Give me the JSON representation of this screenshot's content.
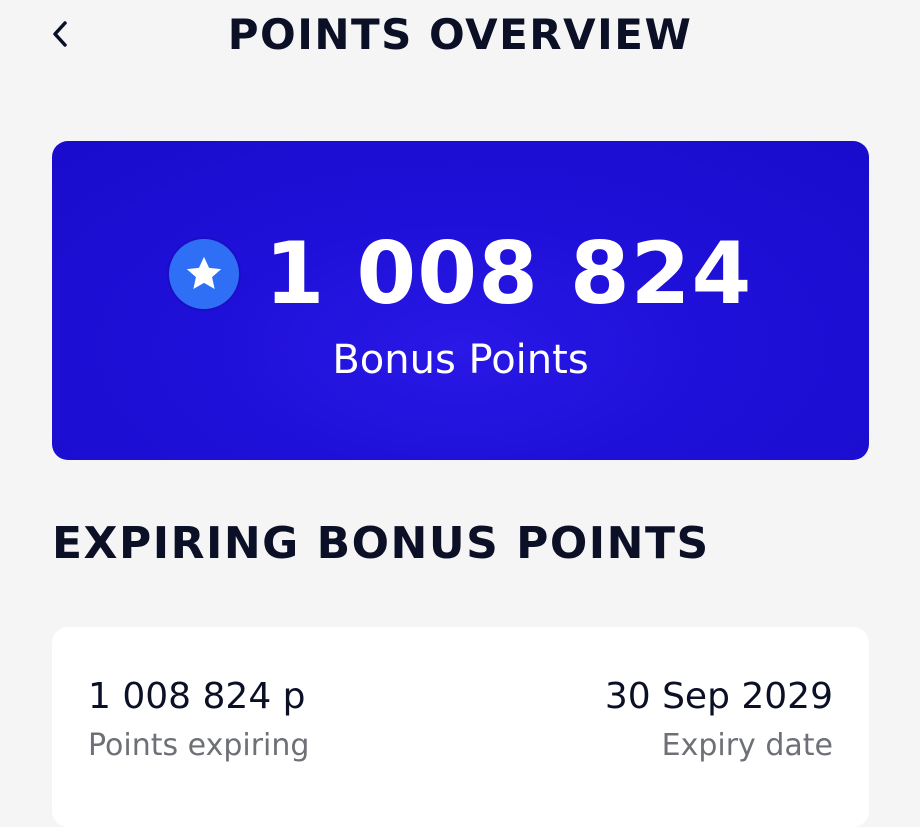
{
  "header": {
    "title": "POINTS OVERVIEW",
    "back_icon": "chevron-left-icon"
  },
  "points_card": {
    "value": "1 008 824",
    "label": "Bonus Points",
    "icon": "star-icon",
    "colors": {
      "card": "#1e10d8",
      "badge": "#2f6ff5"
    }
  },
  "expiring": {
    "heading": "EXPIRING BONUS POINTS",
    "points_value": "1 008 824 p",
    "points_label": "Points expiring",
    "date_value": "30 Sep 2029",
    "date_label": "Expiry date"
  }
}
